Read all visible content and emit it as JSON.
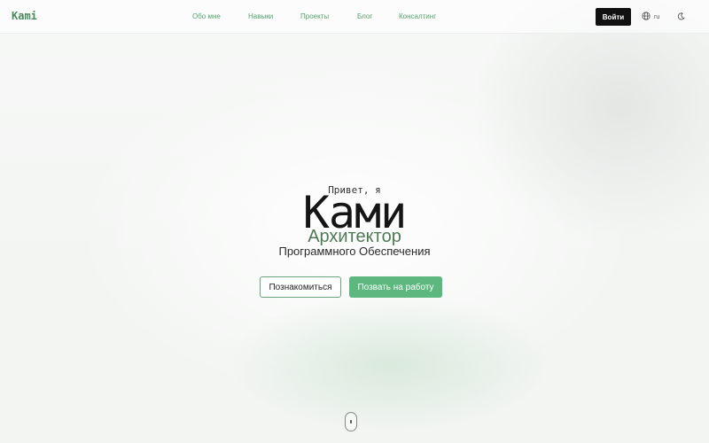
{
  "header": {
    "logo": "Kami",
    "nav": [
      {
        "label": "Обо мне"
      },
      {
        "label": "Навыки"
      },
      {
        "label": "Проекты"
      },
      {
        "label": "Блог"
      },
      {
        "label": "Консалтинг"
      }
    ],
    "login_label": "Войти",
    "language": "ru",
    "icons": {
      "language": "globe-icon",
      "theme": "moon-icon"
    }
  },
  "hero": {
    "greeting": "Привет, я",
    "name": "Kaми",
    "role": "Архитектор",
    "role_sub": "Программного Обеспечения",
    "buttons": {
      "secondary": "Познакомиться",
      "primary": "Позвать на работу"
    }
  },
  "colors": {
    "accent": "#5cb87e",
    "accent_text": "#55a26c",
    "role_text": "#4d7a55",
    "login_bg": "#111111"
  }
}
